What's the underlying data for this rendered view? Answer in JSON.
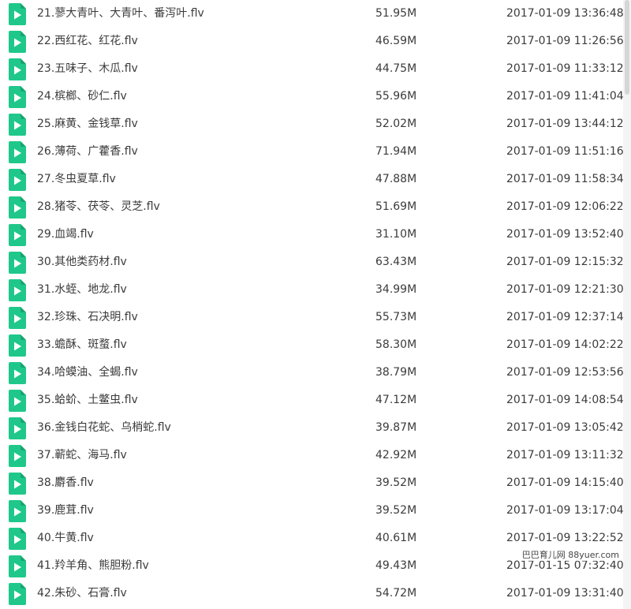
{
  "colors": {
    "icon_green": "#1fc88a",
    "icon_fold": "#16a572",
    "play_white": "#ffffff",
    "text": "#3b3b3b"
  },
  "icon": "video-file-icon",
  "files": [
    {
      "name": "21.蓼大青叶、大青叶、番泻叶.flv",
      "size": "51.95M",
      "date": "2017-01-09 13:36:48"
    },
    {
      "name": "22.西红花、红花.flv",
      "size": "46.59M",
      "date": "2017-01-09 11:26:56"
    },
    {
      "name": "23.五味子、木瓜.flv",
      "size": "44.75M",
      "date": "2017-01-09 11:33:12"
    },
    {
      "name": "24.槟榔、砂仁.flv",
      "size": "55.96M",
      "date": "2017-01-09 11:41:04"
    },
    {
      "name": "25.麻黄、金钱草.flv",
      "size": "52.02M",
      "date": "2017-01-09 13:44:12"
    },
    {
      "name": "26.薄荷、广藿香.flv",
      "size": "71.94M",
      "date": "2017-01-09 11:51:16"
    },
    {
      "name": "27.冬虫夏草.flv",
      "size": "47.88M",
      "date": "2017-01-09 11:58:34"
    },
    {
      "name": "28.猪苓、茯苓、灵芝.flv",
      "size": "51.69M",
      "date": "2017-01-09 12:06:22"
    },
    {
      "name": "29.血竭.flv",
      "size": "31.10M",
      "date": "2017-01-09 13:52:40"
    },
    {
      "name": "30.其他类药材.flv",
      "size": "63.43M",
      "date": "2017-01-09 12:15:32"
    },
    {
      "name": "31.水蛭、地龙.flv",
      "size": "34.99M",
      "date": "2017-01-09 12:21:30"
    },
    {
      "name": "32.珍珠、石决明.flv",
      "size": "55.73M",
      "date": "2017-01-09 12:37:14"
    },
    {
      "name": "33.蟾酥、斑蝥.flv",
      "size": "58.30M",
      "date": "2017-01-09 14:02:22"
    },
    {
      "name": "34.哈蟆油、全蝎.flv",
      "size": "38.79M",
      "date": "2017-01-09 12:53:56"
    },
    {
      "name": "35.蛤蚧、土鳖虫.flv",
      "size": "47.12M",
      "date": "2017-01-09 14:08:54"
    },
    {
      "name": "36.金钱白花蛇、乌梢蛇.flv",
      "size": "39.87M",
      "date": "2017-01-09 13:05:42"
    },
    {
      "name": "37.蕲蛇、海马.flv",
      "size": "42.92M",
      "date": "2017-01-09 13:11:32"
    },
    {
      "name": "38.麝香.flv",
      "size": "39.52M",
      "date": "2017-01-09 14:15:40"
    },
    {
      "name": "39.鹿茸.flv",
      "size": "39.52M",
      "date": "2017-01-09 13:17:04"
    },
    {
      "name": "40.牛黄.flv",
      "size": "40.61M",
      "date": "2017-01-09 13:22:52"
    },
    {
      "name": "41.羚羊角、熊胆粉.flv",
      "size": "49.43M",
      "date": "2017-01-15 07:32:40"
    },
    {
      "name": "42.朱砂、石膏.flv",
      "size": "54.72M",
      "date": "2017-01-09 13:31:40"
    }
  ],
  "watermark": "巴巴育儿网 88yuer.com"
}
